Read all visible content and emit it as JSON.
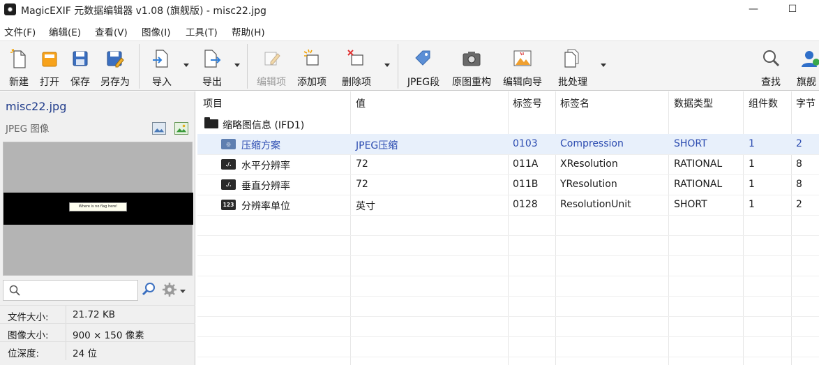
{
  "window": {
    "title": "MagicEXIF 元数据编辑器 v1.08 (旗舰版) - misc22.jpg",
    "minimize": "—",
    "maximize": "☐"
  },
  "menu": [
    "文件(F)",
    "编辑(E)",
    "查看(V)",
    "图像(I)",
    "工具(T)",
    "帮助(H)"
  ],
  "toolbar": {
    "new": "新建",
    "open": "打开",
    "save": "保存",
    "save_as": "另存为",
    "import": "导入",
    "export": "导出",
    "edit_item": "编辑项",
    "add_item": "添加项",
    "delete_item": "删除项",
    "jpeg_segment": "JPEG段",
    "rebuild": "原图重构",
    "wizard": "编辑向导",
    "batch": "批处理",
    "find": "查找",
    "flagship": "旗舰"
  },
  "left": {
    "file_name": "misc22.jpg",
    "file_type": "JPEG 图像",
    "preview_text": "Where is no flag here!",
    "search_placeholder": "",
    "props": [
      {
        "key": "文件大小:",
        "value": "21.72 KB"
      },
      {
        "key": "图像大小:",
        "value": "900 × 150 像素"
      },
      {
        "key": "位深度:",
        "value": "24 位"
      }
    ]
  },
  "table": {
    "headers": [
      "项目",
      "值",
      "标签号",
      "标签名",
      "数据类型",
      "组件数",
      "字节"
    ],
    "group": "缩略图信息 (IFD1)",
    "rows": [
      {
        "icon": "compression-icon",
        "badge": "◎",
        "item": "压缩方案",
        "value": "JPEG压缩",
        "tag": "0103",
        "name": "Compression",
        "type": "SHORT",
        "count": "1",
        "bytes": "2"
      },
      {
        "icon": "rational-icon",
        "badge": "./.",
        "item": "水平分辨率",
        "value": "72",
        "tag": "011A",
        "name": "XResolution",
        "type": "RATIONAL",
        "count": "1",
        "bytes": "8"
      },
      {
        "icon": "rational-icon",
        "badge": "./.",
        "item": "垂直分辨率",
        "value": "72",
        "tag": "011B",
        "name": "YResolution",
        "type": "RATIONAL",
        "count": "1",
        "bytes": "8"
      },
      {
        "icon": "number-icon",
        "badge": "123",
        "item": "分辨率单位",
        "value": "英寸",
        "tag": "0128",
        "name": "ResolutionUnit",
        "type": "SHORT",
        "count": "1",
        "bytes": "2"
      }
    ]
  },
  "colors": {
    "selected_row_bg": "#e8f0fb",
    "selected_text": "#2b4bb0",
    "file_name": "#1e3a8a"
  }
}
